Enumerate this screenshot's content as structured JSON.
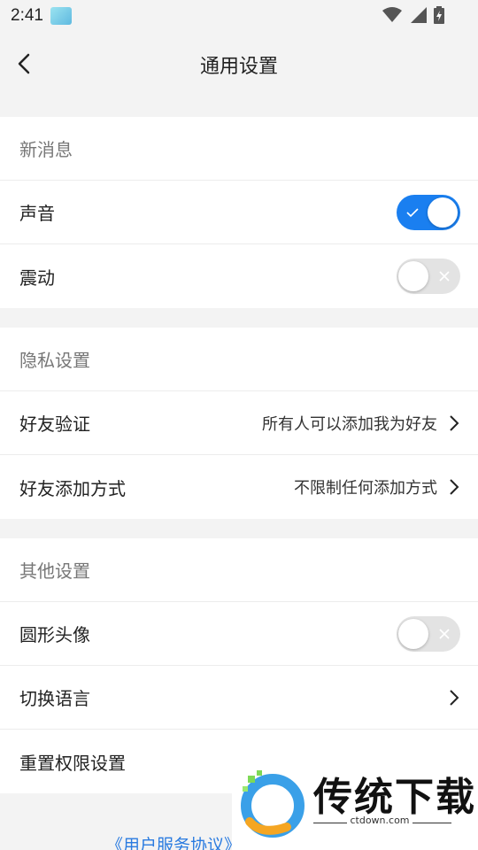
{
  "status_bar": {
    "time": "2:41",
    "icons": [
      "app-icon",
      "wifi-icon",
      "signal-icon",
      "battery-icon"
    ]
  },
  "header": {
    "title": "通用设置"
  },
  "sections": [
    {
      "title": "新消息",
      "rows": [
        {
          "label": "声音",
          "control": "toggle",
          "state": "on"
        },
        {
          "label": "震动",
          "control": "toggle",
          "state": "off"
        }
      ]
    },
    {
      "title": "隐私设置",
      "rows": [
        {
          "label": "好友验证",
          "value": "所有人可以添加我为好友",
          "control": "chevron"
        },
        {
          "label": "好友添加方式",
          "value": "不限制任何添加方式",
          "control": "chevron"
        }
      ]
    },
    {
      "title": "其他设置",
      "rows": [
        {
          "label": "圆形头像",
          "control": "toggle",
          "state": "off"
        },
        {
          "label": "切换语言",
          "control": "chevron"
        },
        {
          "label": "重置权限设置"
        }
      ]
    }
  ],
  "footer": {
    "link_text": "《用户服务协议》"
  },
  "watermark": {
    "brand": "传统下载",
    "domain": "ctdown.com"
  },
  "colors": {
    "accent": "#1a7ff0",
    "toggle_off": "#e3e3e3",
    "background": "#f3f3f3"
  }
}
